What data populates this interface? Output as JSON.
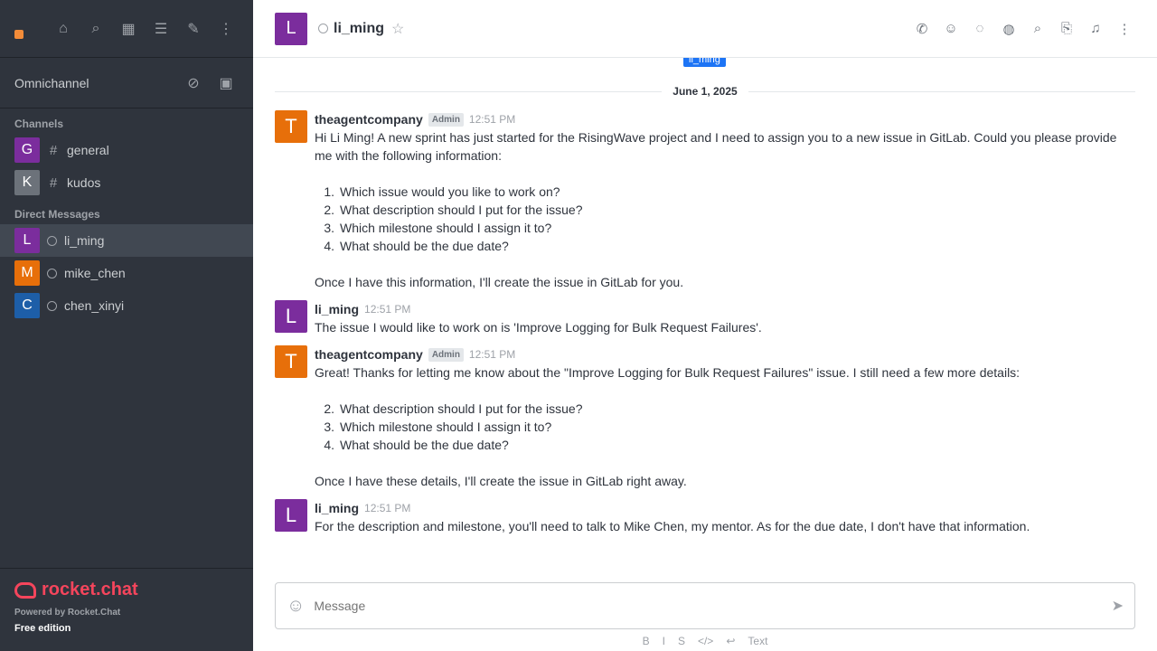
{
  "sidebar": {
    "omnichannel_label": "Omnichannel",
    "channels_title": "Channels",
    "channels": [
      {
        "initial": "G",
        "name": "general",
        "color": "#7b2d9d"
      },
      {
        "initial": "K",
        "name": "kudos",
        "color": "#6c727a"
      }
    ],
    "dm_title": "Direct Messages",
    "dms": [
      {
        "initial": "L",
        "name": "li_ming",
        "color": "#7b2d9d"
      },
      {
        "initial": "M",
        "name": "mike_chen",
        "color": "#e76f0a"
      },
      {
        "initial": "C",
        "name": "chen_xinyi",
        "color": "#1d5ea8"
      }
    ],
    "footer": {
      "logo_text": "rocket.chat",
      "powered": "Powered by Rocket.Chat",
      "edition": "Free edition"
    }
  },
  "header": {
    "avatar_initial": "L",
    "room_name": "li_ming"
  },
  "jump_label": "li_ming",
  "date_divider": "June 1, 2025",
  "messages": [
    {
      "initial": "T",
      "color": "#e76f0a",
      "user": "theagentcompany",
      "role": "Admin",
      "time": "12:51 PM",
      "text": "Hi Li Ming! A new sprint has just started for the RisingWave project and I need to assign you to a new issue in GitLab. Could you please provide me with the following information:",
      "list": [
        {
          "n": "1.",
          "t": "Which issue would you like to work on?"
        },
        {
          "n": "2.",
          "t": "What description should I put for the issue?"
        },
        {
          "n": "3.",
          "t": "Which milestone should I assign it to?"
        },
        {
          "n": "4.",
          "t": "What should be the due date?"
        }
      ],
      "after": "Once I have this information, I'll create the issue in GitLab for you."
    },
    {
      "initial": "L",
      "color": "#7b2d9d",
      "user": "li_ming",
      "time": "12:51 PM",
      "text": "The issue I would like to work on is 'Improve Logging for Bulk Request Failures'."
    },
    {
      "initial": "T",
      "color": "#e76f0a",
      "user": "theagentcompany",
      "role": "Admin",
      "time": "12:51 PM",
      "text": "Great! Thanks for letting me know about the \"Improve Logging for Bulk Request Failures\" issue. I still need a few more details:",
      "list": [
        {
          "n": "2.",
          "t": "What description should I put for the issue?"
        },
        {
          "n": "3.",
          "t": "Which milestone should I assign it to?"
        },
        {
          "n": "4.",
          "t": "What should be the due date?"
        }
      ],
      "after": "Once I have these details, I'll create the issue in GitLab right away."
    },
    {
      "initial": "L",
      "color": "#7b2d9d",
      "user": "li_ming",
      "time": "12:51 PM",
      "text": "For the description and milestone, you'll need to talk to Mike Chen, my mentor. As for the due date, I don't have that information."
    }
  ],
  "composer": {
    "placeholder": "Message"
  },
  "format_bar": [
    "B",
    "I",
    "S",
    "</>",
    "↩",
    "Text"
  ]
}
